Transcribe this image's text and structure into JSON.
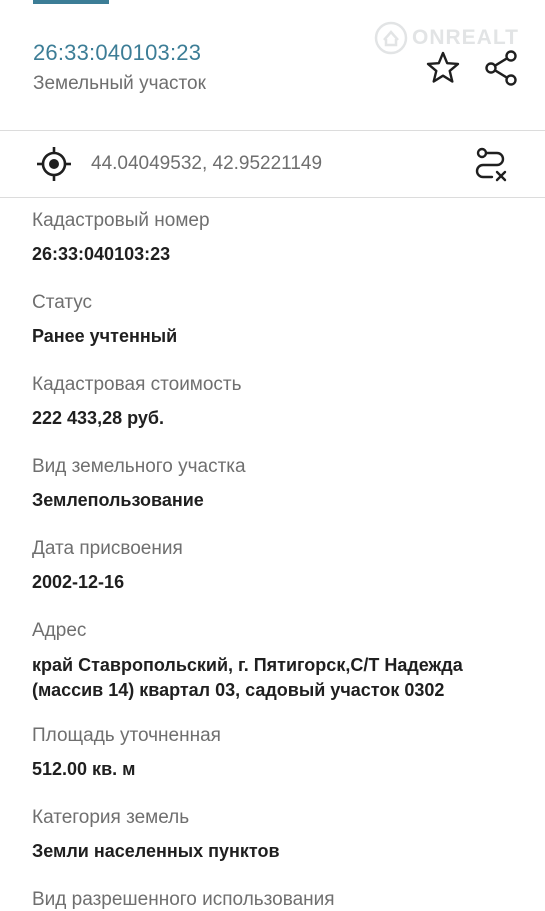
{
  "header": {
    "cadastral_number": "26:33:040103:23",
    "object_type": "Земельный участок",
    "watermark": "ONREALT",
    "accent_color": "#3c7d96"
  },
  "location": {
    "coordinates": "44.04049532, 42.95221149"
  },
  "fields": [
    {
      "label": "Кадастровый номер",
      "value": "26:33:040103:23"
    },
    {
      "label": "Статус",
      "value": "Ранее учтенный"
    },
    {
      "label": "Кадастровая стоимость",
      "value": "222 433,28 руб."
    },
    {
      "label": "Вид земельного участка",
      "value": "Землепользование"
    },
    {
      "label": "Дата присвоения",
      "value": "2002-12-16"
    },
    {
      "label": "Адрес",
      "value_lines": [
        "край Ставропольский, г. Пятигорск,С/Т Надежда",
        "(массив 14) квартал 03, садовый участок 0302"
      ]
    },
    {
      "label": "Площадь уточненная",
      "value": "512.00 кв. м"
    },
    {
      "label": "Категория земель",
      "value": "Земли населенных пунктов"
    },
    {
      "label": "Вид разрешенного использования",
      "value": ""
    }
  ],
  "icons": {
    "favorite": "star-outline-icon",
    "share": "share-icon",
    "locate": "target-icon",
    "route": "route-icon"
  }
}
